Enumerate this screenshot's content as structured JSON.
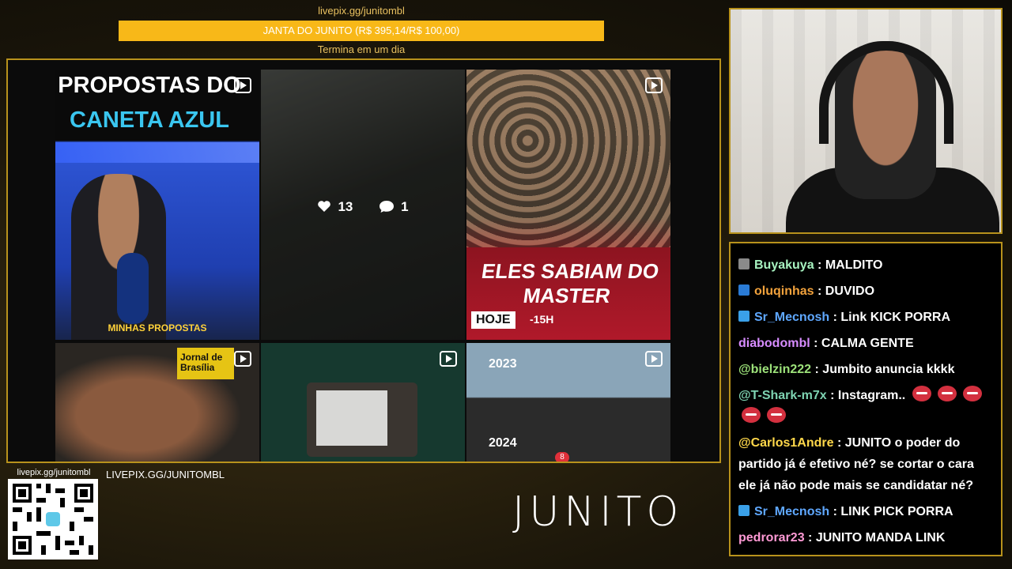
{
  "donation": {
    "url": "livepix.gg/junitombl",
    "goal_label": "JANTA DO JUNITO (R$ 395,14/R$ 100,00)",
    "goal_progress": 1.0,
    "ends": "Termina em um dia",
    "bar_color": "#f6b01a"
  },
  "feed": {
    "tile1": {
      "title_line1": "PROPOSTAS DO",
      "title_line2": "CANETA AZUL",
      "caption": "MINHAS PROPOSTAS",
      "icon": "video-icon"
    },
    "tile2": {
      "likes": "13",
      "comments": "1",
      "like_icon": "heart-icon",
      "comment_icon": "comment-icon"
    },
    "tile3": {
      "slogan": "ELES SABIAM DO MASTER",
      "hoje": "HOJE",
      "hora": "-15H",
      "icon": "video-icon"
    },
    "tile4": {
      "badge": "Jornal de Brasília",
      "icon": "video-icon"
    },
    "tile5": {
      "icon": "video-icon"
    },
    "tile6": {
      "year_top": "2023",
      "year_bottom": "2024",
      "icon": "video-icon"
    },
    "notification_count": "8"
  },
  "chat": {
    "messages": [
      {
        "user": "Buyakuya",
        "text": ": MALDITO",
        "color": "#a7f3c0",
        "badge": "#8a8a8a"
      },
      {
        "user": "oluqinhas",
        "text": ": DUVIDO",
        "color": "#f2a23c",
        "badge": "#2a7bd6"
      },
      {
        "user": "Sr_Mecnosh",
        "text": ": Link KICK PORRA",
        "color": "#5fa8ff",
        "badge": "#3aa0e8"
      },
      {
        "user": "diabodombl",
        "text": ": CALMA GENTE",
        "color": "#d78cff",
        "badge": ""
      },
      {
        "user": "@bielzin222",
        "text": ": Jumbito anuncia kkkk",
        "color": "#9de27a",
        "badge": ""
      },
      {
        "user": "@T-Shark-m7x",
        "text": ": Instagram..",
        "color": "#7ed3b2",
        "badge": ""
      },
      {
        "user": "@Carlos1Andre",
        "text": ": JUNITO o poder do partido já é efetivo né? se cortar o cara ele já não pode mais se candidatar né?",
        "color": "#ffd84a",
        "badge": ""
      },
      {
        "user": "Sr_Mecnosh",
        "text": ": LINK PICK PORRA",
        "color": "#5fa8ff",
        "badge": "#3aa0e8"
      },
      {
        "user": "pedrorar23",
        "text": ": JUNITO MANDA LINK",
        "color": "#ff9ad5",
        "badge": ""
      }
    ]
  },
  "footer": {
    "qr_url": "livepix.gg/junitombl",
    "url": "LIVEPIX.GG/JUNITOMBL",
    "logo": "JUNITO"
  }
}
